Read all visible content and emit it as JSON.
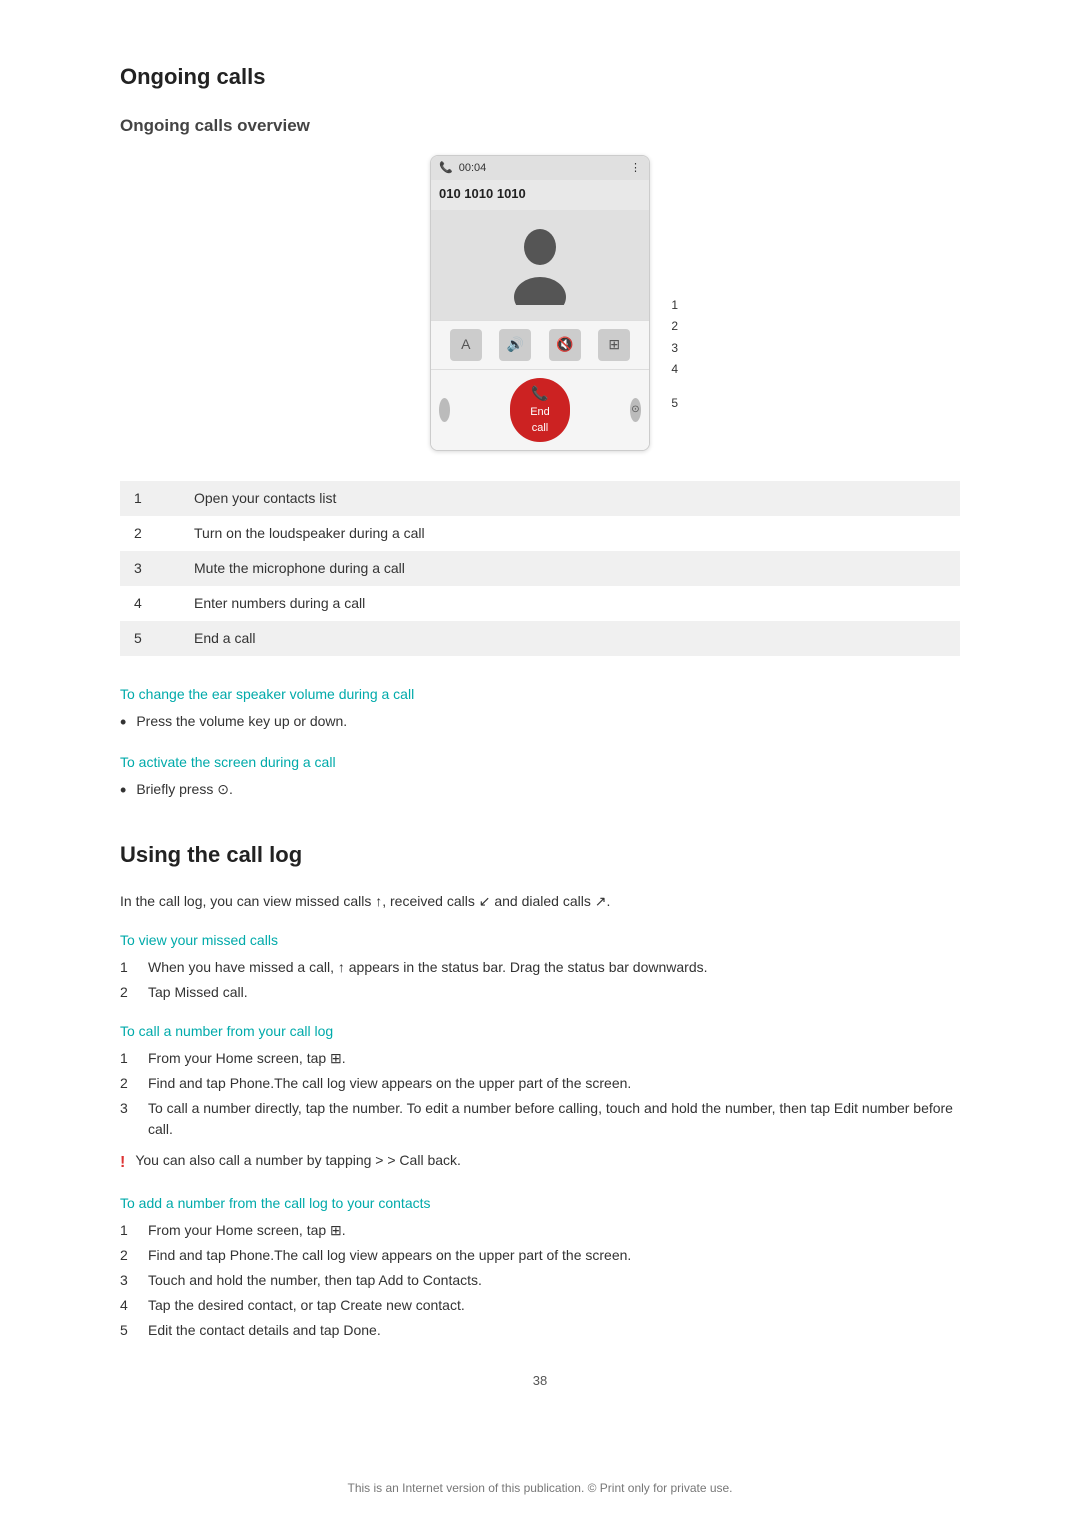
{
  "page": {
    "title": "Ongoing calls",
    "subtitle": "Ongoing calls overview",
    "phone_mock": {
      "status_time": "00:04",
      "phone_number": "010 1010 1010",
      "controls": [
        {
          "icon": "A",
          "label": "contacts"
        },
        {
          "icon": "♦",
          "label": "speaker"
        },
        {
          "icon": "✕",
          "label": "mute"
        },
        {
          "icon": "⊞",
          "label": "keypad"
        }
      ],
      "end_call_label": "End call"
    },
    "diagram_items": [
      {
        "num": "1",
        "desc": "Open your contacts list"
      },
      {
        "num": "2",
        "desc": "Turn on the loudspeaker during a call"
      },
      {
        "num": "3",
        "desc": "Mute the microphone during a call"
      },
      {
        "num": "4",
        "desc": "Enter numbers during a call"
      },
      {
        "num": "5",
        "desc": "End a call"
      }
    ],
    "tip1": {
      "heading": "To change the ear speaker volume during a call",
      "bullet": "Press the volume key up or down."
    },
    "tip2": {
      "heading": "To activate the screen during a call",
      "bullet": "Briefly press ⊙."
    },
    "section2": {
      "title": "Using the call log",
      "intro": "In the call log, you can view missed calls ↑, received calls ↙ and dialed calls ↗.",
      "tip_missed": {
        "heading": "To view your missed calls",
        "steps": [
          "When you have missed a call, ↑ appears in the status bar. Drag the status bar downwards.",
          "Tap Missed call."
        ]
      },
      "tip_call_log": {
        "heading": "To call a number from your call log",
        "steps": [
          "From your Home screen, tap ⊞.",
          "Find and tap Phone.The call log view appears on the upper part of the screen.",
          "To call a number directly, tap the number. To edit a number before calling, touch and hold the number, then tap Edit number before call."
        ],
        "warning": "You can also call a number by tapping > > Call back."
      },
      "tip_add": {
        "heading": "To add a number from the call log to your contacts",
        "steps": [
          "From your Home screen, tap ⊞.",
          "Find and tap Phone.The call log view appears on the upper part of the screen.",
          "Touch and hold the number, then tap Add to Contacts.",
          "Tap the desired contact, or tap Create new contact.",
          "Edit the contact details and tap Done."
        ]
      }
    },
    "page_number": "38",
    "footer": "This is an Internet version of this publication. © Print only for private use."
  }
}
